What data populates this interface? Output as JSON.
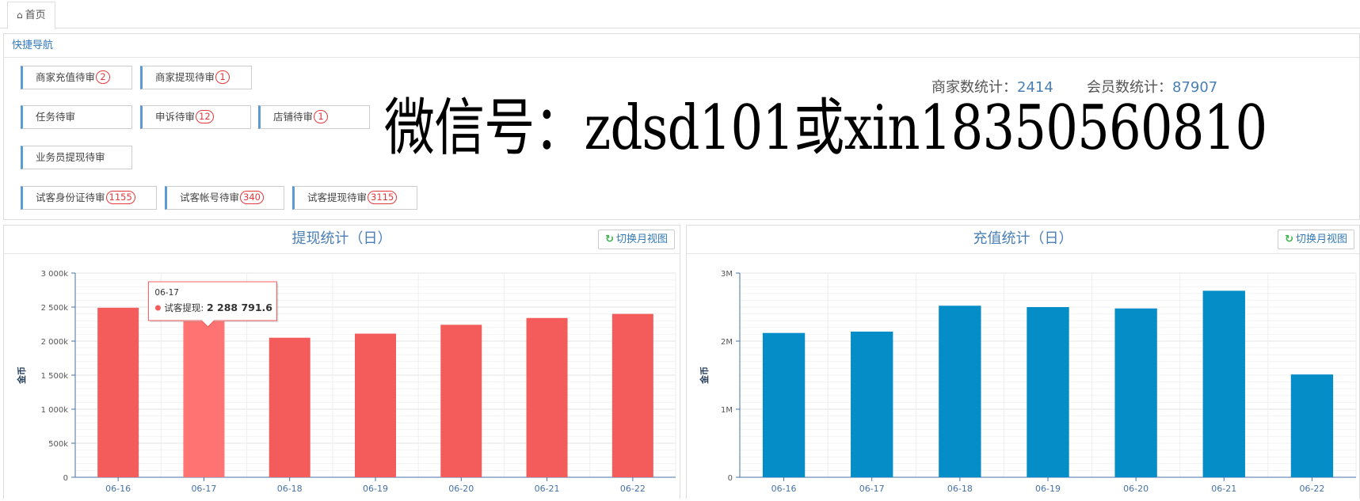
{
  "tabs": [
    {
      "icon": "home-icon",
      "label": "首页"
    }
  ],
  "quicknav": {
    "title": "快捷导航",
    "items": [
      {
        "label": "商家充值待审",
        "count": "2"
      },
      {
        "label": "商家提现待审",
        "count": "1"
      },
      {
        "label": "任务待审",
        "count": ""
      },
      {
        "label": "申诉待审",
        "count": "12"
      },
      {
        "label": "店铺待审",
        "count": "1"
      },
      {
        "label": "业务员提现待审",
        "count": ""
      },
      {
        "label": "试客身份证待审",
        "count": "1155"
      },
      {
        "label": "试客帐号待审",
        "count": "340"
      },
      {
        "label": "试客提现待审",
        "count": "3115"
      }
    ]
  },
  "stats": {
    "merchant_label": "商家数统计：",
    "merchant_value": "2414",
    "member_label": "会员数统计：",
    "member_value": "87907"
  },
  "watermark": "微信号：zdsd101或xin18350560810",
  "colors": {
    "withdraw": "#f45b5b",
    "withdraw_hover": "#ff7373",
    "recharge": "#058dc7",
    "link": "#337ab7"
  },
  "panels": {
    "withdraw": {
      "title": "提现统计（日）",
      "switch_label": "切换月视图"
    },
    "recharge": {
      "title": "充值统计（日）",
      "switch_label": "切换月视图"
    }
  },
  "chart_data": [
    {
      "type": "bar",
      "title": "提现统计（日）",
      "ylabel": "金币",
      "categories": [
        "06-16",
        "06-17",
        "06-18",
        "06-19",
        "06-20",
        "06-21",
        "06-22"
      ],
      "series": [
        {
          "name": "试客提现",
          "values": [
            2490000,
            2288791.6,
            2050000,
            2110000,
            2240000,
            2340000,
            2400000
          ]
        }
      ],
      "ylim": [
        0,
        3000000
      ],
      "yticks": [
        "0",
        "500k",
        "1 000k",
        "1 500k",
        "2 000k",
        "2 500k",
        "3 000k"
      ],
      "grid": true,
      "tooltip": {
        "category": "06-17",
        "series": "试客提现",
        "value": "2 288 791.6"
      }
    },
    {
      "type": "bar",
      "title": "充值统计（日）",
      "ylabel": "金币",
      "categories": [
        "06-16",
        "06-17",
        "06-18",
        "06-19",
        "06-20",
        "06-21",
        "06-22"
      ],
      "series": [
        {
          "values": [
            2120000,
            2140000,
            2520000,
            2500000,
            2480000,
            2740000,
            1510000
          ]
        }
      ],
      "ylim": [
        0,
        3000000
      ],
      "yticks": [
        "0",
        "1M",
        "2M",
        "3M"
      ],
      "grid": true
    }
  ]
}
